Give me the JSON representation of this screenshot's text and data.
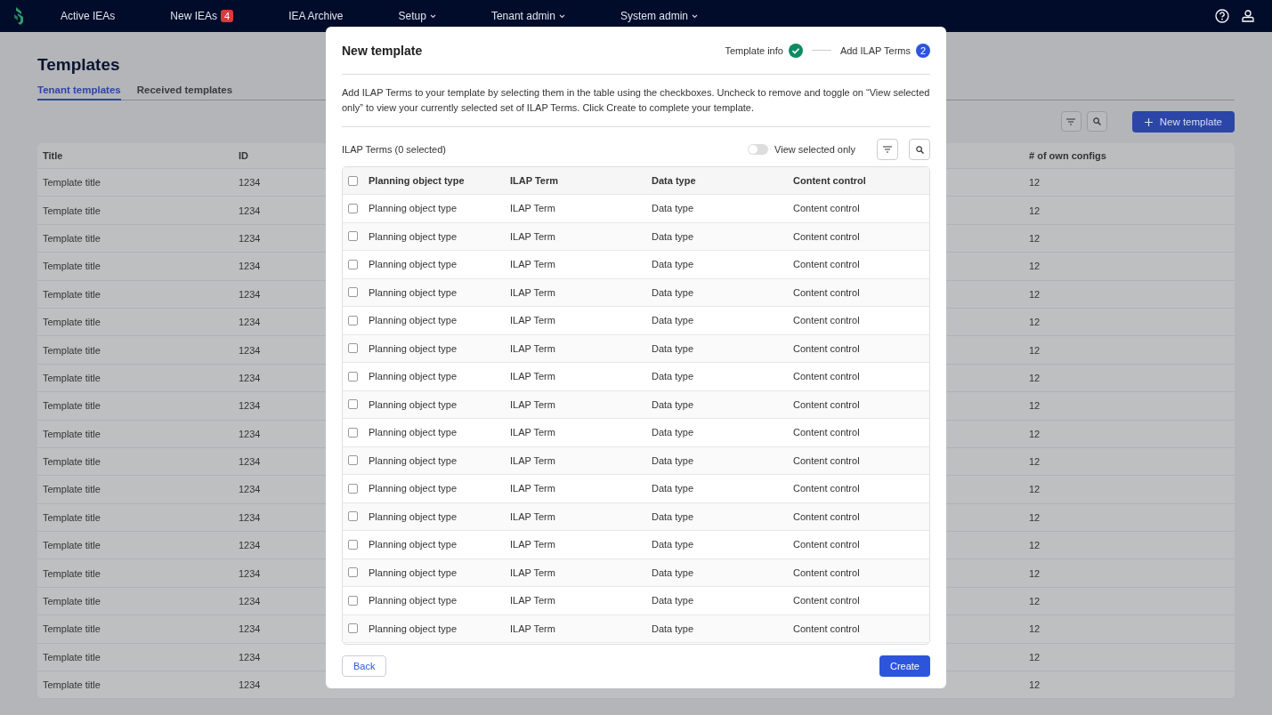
{
  "nav": {
    "items": [
      {
        "label": "Active IEAs",
        "dropdown": false
      },
      {
        "label": "New IEAs",
        "badge": "4",
        "dropdown": false
      },
      {
        "label": "IEA Archive",
        "dropdown": false
      },
      {
        "label": "Setup",
        "dropdown": true
      },
      {
        "label": "Tenant admin",
        "dropdown": true
      },
      {
        "label": "System admin",
        "dropdown": true
      }
    ]
  },
  "page": {
    "title": "Templates",
    "tabs": [
      {
        "label": "Tenant templates",
        "selected": true
      },
      {
        "label": "Received templates",
        "selected": false
      }
    ],
    "new_button": "New template",
    "table": {
      "columns": [
        "Title",
        "ID",
        "# of own configs"
      ],
      "rows": [
        [
          "Template title",
          "1234",
          "12"
        ],
        [
          "Template title",
          "1234",
          "12"
        ],
        [
          "Template title",
          "1234",
          "12"
        ],
        [
          "Template title",
          "1234",
          "12"
        ],
        [
          "Template title",
          "1234",
          "12"
        ],
        [
          "Template title",
          "1234",
          "12"
        ],
        [
          "Template title",
          "1234",
          "12"
        ],
        [
          "Template title",
          "1234",
          "12"
        ],
        [
          "Template title",
          "1234",
          "12"
        ],
        [
          "Template title",
          "1234",
          "12"
        ],
        [
          "Template title",
          "1234",
          "12"
        ],
        [
          "Template title",
          "1234",
          "12"
        ],
        [
          "Template title",
          "1234",
          "12"
        ],
        [
          "Template title",
          "1234",
          "12"
        ],
        [
          "Template title",
          "1234",
          "12"
        ],
        [
          "Template title",
          "1234",
          "12"
        ],
        [
          "Template title",
          "1234",
          "12"
        ],
        [
          "Template title",
          "1234",
          "12"
        ],
        [
          "Template title",
          "1234",
          "12"
        ]
      ]
    }
  },
  "modal": {
    "title": "New template",
    "steps": [
      {
        "label": "Template info",
        "done": true
      },
      {
        "label": "Add ILAP Terms",
        "done": false,
        "number": "2"
      }
    ],
    "description": "Add ILAP Terms to your template by selecting them in the table using the checkboxes. Uncheck to remove and toggle on “View selected only” to view your currently selected set of ILAP Terms. Click Create to complete your template.",
    "terms_title": "ILAP Terms (0 selected)",
    "toggle": {
      "label": "View selected only",
      "on": false
    },
    "select_all": {
      "checked": false
    },
    "columns": [
      "Planning object type",
      "ILAP Term",
      "Data type",
      "Content control"
    ],
    "rows": [
      {
        "checked": false,
        "cells": [
          "Planning object type",
          "ILAP Term",
          "Data type",
          "Content control"
        ]
      },
      {
        "checked": false,
        "cells": [
          "Planning object type",
          "ILAP Term",
          "Data type",
          "Content control"
        ]
      },
      {
        "checked": false,
        "cells": [
          "Planning object type",
          "ILAP Term",
          "Data type",
          "Content control"
        ]
      },
      {
        "checked": false,
        "cells": [
          "Planning object type",
          "ILAP Term",
          "Data type",
          "Content control"
        ]
      },
      {
        "checked": false,
        "cells": [
          "Planning object type",
          "ILAP Term",
          "Data type",
          "Content control"
        ]
      },
      {
        "checked": false,
        "cells": [
          "Planning object type",
          "ILAP Term",
          "Data type",
          "Content control"
        ]
      },
      {
        "checked": false,
        "cells": [
          "Planning object type",
          "ILAP Term",
          "Data type",
          "Content control"
        ]
      },
      {
        "checked": false,
        "cells": [
          "Planning object type",
          "ILAP Term",
          "Data type",
          "Content control"
        ]
      },
      {
        "checked": false,
        "cells": [
          "Planning object type",
          "ILAP Term",
          "Data type",
          "Content control"
        ]
      },
      {
        "checked": false,
        "cells": [
          "Planning object type",
          "ILAP Term",
          "Data type",
          "Content control"
        ]
      },
      {
        "checked": false,
        "cells": [
          "Planning object type",
          "ILAP Term",
          "Data type",
          "Content control"
        ]
      },
      {
        "checked": false,
        "cells": [
          "Planning object type",
          "ILAP Term",
          "Data type",
          "Content control"
        ]
      },
      {
        "checked": false,
        "cells": [
          "Planning object type",
          "ILAP Term",
          "Data type",
          "Content control"
        ]
      },
      {
        "checked": false,
        "cells": [
          "Planning object type",
          "ILAP Term",
          "Data type",
          "Content control"
        ]
      },
      {
        "checked": false,
        "cells": [
          "Planning object type",
          "ILAP Term",
          "Data type",
          "Content control"
        ]
      },
      {
        "checked": false,
        "cells": [
          "Planning object type",
          "ILAP Term",
          "Data type",
          "Content control"
        ]
      }
    ],
    "back_button": "Back",
    "create_button": "Create"
  }
}
